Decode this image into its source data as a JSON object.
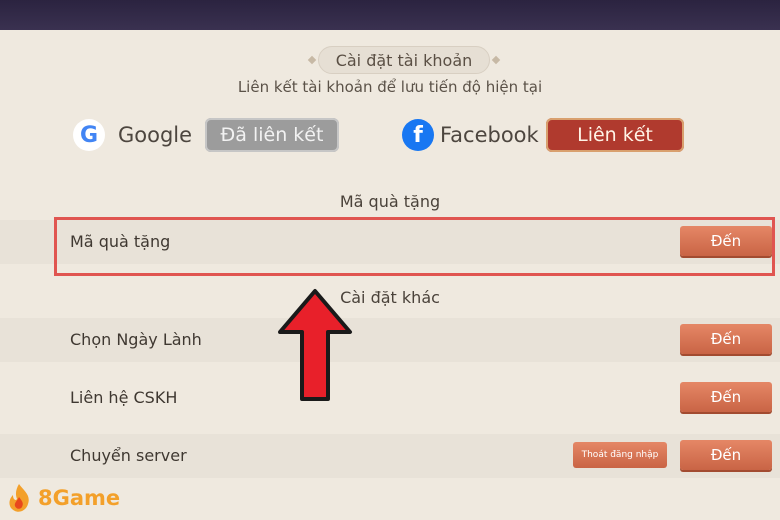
{
  "header": {
    "title": "Cài đặt tài khoản",
    "subtitle": "Liên kết tài khoản để lưu tiến độ hiện tại"
  },
  "accounts": {
    "google": {
      "icon": "google-icon",
      "name": "Google",
      "status": "Đã liên kết"
    },
    "facebook": {
      "icon": "facebook-icon",
      "name": "Facebook",
      "action": "Liên kết"
    }
  },
  "gift_section": {
    "title": "Mã quà tặng",
    "row": {
      "label": "Mã quà tặng",
      "button": "Đến"
    }
  },
  "other_section": {
    "title": "Cài đặt khác",
    "rows": [
      {
        "label": "Chọn Ngày Lành",
        "button": "Đến"
      },
      {
        "label": "Liên hệ CSKH",
        "button": "Đến"
      },
      {
        "label": "Chuyển server",
        "button": "Đến",
        "secondary_button": "Thoát đăng nhập"
      }
    ]
  },
  "annotation": {
    "arrow_color": "#e8202a",
    "box_color": "#e05550"
  },
  "watermark": {
    "text": "8Game",
    "color": "#f3a02a"
  }
}
